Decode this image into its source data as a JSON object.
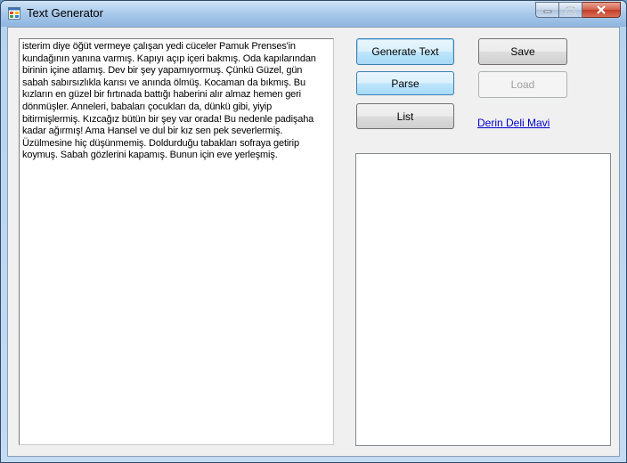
{
  "window": {
    "title": "Text Generator",
    "icon": "app-icon"
  },
  "caption": {
    "minimize_icon": "minimize-icon",
    "maximize_icon": "maximize-icon",
    "close_icon": "close-icon"
  },
  "text_area": {
    "value": "isterim diye öğüt vermeye çalışan yedi cüceler Pamuk Prenses'in kundağının yanına varmış. Kapıyı açıp içeri bakmış. Oda kapılarından birinin içine atlamış. Dev bir şey yapamıyormuş. Çünkü Güzel, gün sabah sabırsızlıkla karısı ve anında ölmüş. Kocaman da bıkmış. Bu kızların en güzel bir fırtınada battığı haberini alır almaz hemen geri dönmüşler. Anneleri, babaları çocukları da, dünkü gibi, yiyip bitirmişlermiş. Kızcağız bütün bir şey var orada! Bu nedenle padişaha kadar ağırmış! Ama Hansel ve dul bir kız sen pek severlermiş. Üzülmesine hiç düşünmemiş. Doldurduğu tabakları sofraya getirip koymuş. Sabah gözlerini kapamış. Bunun için eve yerleşmiş."
  },
  "buttons": {
    "generate": "Generate Text",
    "parse": "Parse",
    "list": "List",
    "save": "Save",
    "load": "Load"
  },
  "link": {
    "label": "Derin Deli Mavi"
  },
  "colors": {
    "link": "#0000cc",
    "accent": "#3c7fb1",
    "window_face": "#f0f0f0"
  }
}
